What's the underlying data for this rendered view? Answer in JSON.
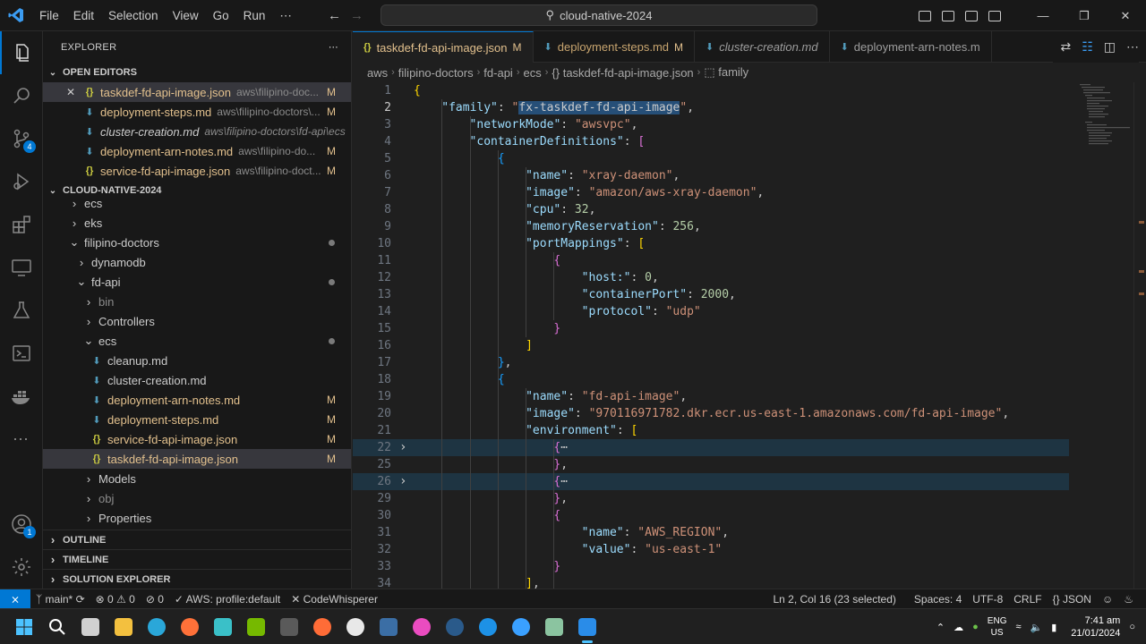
{
  "menu": [
    "File",
    "Edit",
    "Selection",
    "View",
    "Go",
    "Run",
    "⋯"
  ],
  "search": "cloud-native-2024",
  "window_controls": [
    "—",
    "❐",
    "✕"
  ],
  "activity": {
    "scm_badge": "4",
    "account_badge": "1"
  },
  "sidebar": {
    "title": "EXPLORER",
    "more": "⋯",
    "open_editors_header": "OPEN EDITORS",
    "open_editors": [
      {
        "name": "taskdef-fd-api-image.json",
        "path": "aws\\filipino-doc...",
        "status": "M",
        "icon": "{}",
        "type": "json"
      },
      {
        "name": "deployment-steps.md",
        "path": "aws\\filipino-doctors\\...",
        "status": "M",
        "icon": "⬇",
        "type": "md"
      },
      {
        "name": "cluster-creation.md",
        "path": "aws\\filipino-doctors\\fd-api\\ecs",
        "status": "",
        "icon": "⬇",
        "type": "md"
      },
      {
        "name": "deployment-arn-notes.md",
        "path": "aws\\filipino-do...",
        "status": "M",
        "icon": "⬇",
        "type": "md"
      },
      {
        "name": "service-fd-api-image.json",
        "path": "aws\\filipino-doct...",
        "status": "M",
        "icon": "{}",
        "type": "json"
      }
    ],
    "workspace_header": "CLOUD-NATIVE-2024",
    "tree": [
      {
        "label": "ecs",
        "depth": 1,
        "chev": "›",
        "type": "folder"
      },
      {
        "label": "eks",
        "depth": 1,
        "chev": "›",
        "type": "folder"
      },
      {
        "label": "filipino-doctors",
        "depth": 1,
        "chev": "⌄",
        "type": "folder"
      },
      {
        "label": "dynamodb",
        "depth": 2,
        "chev": "›",
        "type": "folder"
      },
      {
        "label": "fd-api",
        "depth": 2,
        "chev": "⌄",
        "type": "folder"
      },
      {
        "label": "bin",
        "depth": 3,
        "chev": "›",
        "type": "folder-dim"
      },
      {
        "label": "Controllers",
        "depth": 3,
        "chev": "›",
        "type": "folder"
      },
      {
        "label": "ecs",
        "depth": 3,
        "chev": "⌄",
        "type": "folder"
      },
      {
        "label": "cleanup.md",
        "depth": 4,
        "icon": "⬇",
        "type": "md",
        "status": ""
      },
      {
        "label": "cluster-creation.md",
        "depth": 4,
        "icon": "⬇",
        "type": "md",
        "status": ""
      },
      {
        "label": "deployment-arn-notes.md",
        "depth": 4,
        "icon": "⬇",
        "type": "md",
        "status": "M"
      },
      {
        "label": "deployment-steps.md",
        "depth": 4,
        "icon": "⬇",
        "type": "md",
        "status": "M"
      },
      {
        "label": "service-fd-api-image.json",
        "depth": 4,
        "icon": "{}",
        "type": "json",
        "status": "M"
      },
      {
        "label": "taskdef-fd-api-image.json",
        "depth": 4,
        "icon": "{}",
        "type": "json",
        "status": "M"
      },
      {
        "label": "Models",
        "depth": 3,
        "chev": "›",
        "type": "folder"
      },
      {
        "label": "obj",
        "depth": 3,
        "chev": "›",
        "type": "folder-dim"
      },
      {
        "label": "Properties",
        "depth": 3,
        "chev": "›",
        "type": "folder"
      }
    ],
    "bottom_sections": [
      "OUTLINE",
      "TIMELINE",
      "SOLUTION EXPLORER"
    ]
  },
  "tabs": [
    {
      "label": "taskdef-fd-api-image.json",
      "status": "M",
      "icon": "{}",
      "active": true,
      "italic": false
    },
    {
      "label": "deployment-steps.md",
      "status": "M",
      "icon": "⬇",
      "active": false,
      "italic": false
    },
    {
      "label": "cluster-creation.md",
      "status": "",
      "icon": "⬇",
      "active": false,
      "italic": true
    },
    {
      "label": "deployment-arn-notes.m",
      "status": "",
      "icon": "⬇",
      "active": false,
      "italic": false
    }
  ],
  "breadcrumb": [
    "aws",
    "filipino-doctors",
    "fd-api",
    "ecs",
    "{} taskdef-fd-api-image.json",
    "⬚ family"
  ],
  "editor": {
    "current_line": "2",
    "lines": [
      {
        "n": "1",
        "indent": 0,
        "tokens": [
          [
            "b1",
            "{"
          ]
        ]
      },
      {
        "n": "2",
        "indent": 1,
        "tokens": [
          [
            "k",
            "\"family\""
          ],
          [
            "p",
            ": "
          ],
          [
            "s",
            "\""
          ],
          [
            "sel",
            "fx-taskdef-fd-api-image"
          ],
          [
            "s",
            "\""
          ],
          [
            "p",
            ","
          ]
        ]
      },
      {
        "n": "3",
        "indent": 2,
        "tokens": [
          [
            "k",
            "\"networkMode\""
          ],
          [
            "p",
            ": "
          ],
          [
            "s",
            "\"awsvpc\""
          ],
          [
            "p",
            ","
          ]
        ]
      },
      {
        "n": "4",
        "indent": 2,
        "tokens": [
          [
            "k",
            "\"containerDefinitions\""
          ],
          [
            "p",
            ": "
          ],
          [
            "b2",
            "["
          ]
        ]
      },
      {
        "n": "5",
        "indent": 3,
        "tokens": [
          [
            "b3",
            "{"
          ]
        ]
      },
      {
        "n": "6",
        "indent": 4,
        "tokens": [
          [
            "k",
            "\"name\""
          ],
          [
            "p",
            ": "
          ],
          [
            "s",
            "\"xray-daemon\""
          ],
          [
            "p",
            ","
          ]
        ]
      },
      {
        "n": "7",
        "indent": 4,
        "tokens": [
          [
            "k",
            "\"image\""
          ],
          [
            "p",
            ": "
          ],
          [
            "s",
            "\"amazon/aws-xray-daemon\""
          ],
          [
            "p",
            ","
          ]
        ]
      },
      {
        "n": "8",
        "indent": 4,
        "tokens": [
          [
            "k",
            "\"cpu\""
          ],
          [
            "p",
            ": "
          ],
          [
            "n",
            "32"
          ],
          [
            "p",
            ","
          ]
        ]
      },
      {
        "n": "9",
        "indent": 4,
        "tokens": [
          [
            "k",
            "\"memoryReservation\""
          ],
          [
            "p",
            ": "
          ],
          [
            "n",
            "256"
          ],
          [
            "p",
            ","
          ]
        ]
      },
      {
        "n": "10",
        "indent": 4,
        "tokens": [
          [
            "k",
            "\"portMappings\""
          ],
          [
            "p",
            ": "
          ],
          [
            "b1",
            "["
          ]
        ]
      },
      {
        "n": "11",
        "indent": 5,
        "tokens": [
          [
            "b2",
            "{"
          ]
        ]
      },
      {
        "n": "12",
        "indent": 6,
        "tokens": [
          [
            "k",
            "\"host:\""
          ],
          [
            "p",
            ": "
          ],
          [
            "n",
            "0"
          ],
          [
            "p",
            ","
          ]
        ]
      },
      {
        "n": "13",
        "indent": 6,
        "tokens": [
          [
            "k",
            "\"containerPort\""
          ],
          [
            "p",
            ": "
          ],
          [
            "n",
            "2000"
          ],
          [
            "p",
            ","
          ]
        ]
      },
      {
        "n": "14",
        "indent": 6,
        "tokens": [
          [
            "k",
            "\"protocol\""
          ],
          [
            "p",
            ": "
          ],
          [
            "s",
            "\"udp\""
          ]
        ]
      },
      {
        "n": "15",
        "indent": 5,
        "tokens": [
          [
            "b2",
            "}"
          ]
        ]
      },
      {
        "n": "16",
        "indent": 4,
        "tokens": [
          [
            "b1",
            "]"
          ]
        ]
      },
      {
        "n": "17",
        "indent": 3,
        "tokens": [
          [
            "b3",
            "}"
          ],
          [
            "p",
            ","
          ]
        ]
      },
      {
        "n": "18",
        "indent": 3,
        "tokens": [
          [
            "b3",
            "{"
          ]
        ]
      },
      {
        "n": "19",
        "indent": 4,
        "tokens": [
          [
            "k",
            "\"name\""
          ],
          [
            "p",
            ": "
          ],
          [
            "s",
            "\"fd-api-image\""
          ],
          [
            "p",
            ","
          ]
        ]
      },
      {
        "n": "20",
        "indent": 4,
        "tokens": [
          [
            "k",
            "\"image\""
          ],
          [
            "p",
            ": "
          ],
          [
            "s",
            "\"970116971782.dkr.ecr.us-east-1.amazonaws.com/fd-api-image\""
          ],
          [
            "p",
            ","
          ]
        ]
      },
      {
        "n": "21",
        "indent": 4,
        "tokens": [
          [
            "k",
            "\"environment\""
          ],
          [
            "p",
            ": "
          ],
          [
            "b1",
            "["
          ]
        ]
      },
      {
        "n": "22",
        "indent": 5,
        "fold": true,
        "tokens": [
          [
            "b2",
            "{"
          ],
          [
            "p",
            "⋯"
          ]
        ]
      },
      {
        "n": "25",
        "indent": 5,
        "tokens": [
          [
            "b2",
            "}"
          ],
          [
            "p",
            ","
          ]
        ]
      },
      {
        "n": "26",
        "indent": 5,
        "fold": true,
        "tokens": [
          [
            "b2",
            "{"
          ],
          [
            "p",
            "⋯"
          ]
        ]
      },
      {
        "n": "29",
        "indent": 5,
        "tokens": [
          [
            "b2",
            "}"
          ],
          [
            "p",
            ","
          ]
        ]
      },
      {
        "n": "30",
        "indent": 5,
        "tokens": [
          [
            "b2",
            "{"
          ]
        ]
      },
      {
        "n": "31",
        "indent": 6,
        "tokens": [
          [
            "k",
            "\"name\""
          ],
          [
            "p",
            ": "
          ],
          [
            "s",
            "\"AWS_REGION\""
          ],
          [
            "p",
            ","
          ]
        ]
      },
      {
        "n": "32",
        "indent": 6,
        "tokens": [
          [
            "k",
            "\"value\""
          ],
          [
            "p",
            ": "
          ],
          [
            "s",
            "\"us-east-1\""
          ]
        ]
      },
      {
        "n": "33",
        "indent": 5,
        "tokens": [
          [
            "b2",
            "}"
          ]
        ]
      },
      {
        "n": "34",
        "indent": 4,
        "tokens": [
          [
            "b1",
            "]"
          ],
          [
            "p",
            ","
          ]
        ]
      }
    ]
  },
  "statusbar": {
    "remote": "⨯",
    "branch": "main*",
    "sync": "⟳",
    "errors": "⊗ 0",
    "warnings": "⚠ 0",
    "ports": "⊘ 0",
    "aws": "✓ AWS: profile:default",
    "codewhisperer": "✕ CodeWhisperer",
    "position": "Ln 2, Col 16 (23 selected)",
    "spaces": "Spaces: 4",
    "encoding": "UTF-8",
    "eol": "CRLF",
    "language": "{} JSON"
  },
  "taskbar": {
    "lang_top": "ENG",
    "lang_bottom": "US",
    "time": "7:41 am",
    "date": "21/01/2024",
    "icons": [
      {
        "name": "start-icon",
        "color": "#4cc2ff"
      },
      {
        "name": "search-taskbar-icon",
        "color": "#ffffff"
      },
      {
        "name": "task-view-icon",
        "color": "#d0d0d0"
      },
      {
        "name": "file-explorer-icon",
        "color": "#f3c03f"
      },
      {
        "name": "edge-icon",
        "color": "#2aa7d9"
      },
      {
        "name": "firefox-icon",
        "color": "#ff7139"
      },
      {
        "name": "store-icon",
        "color": "#3ac0c8"
      },
      {
        "name": "nvidia-icon",
        "color": "#76b900"
      },
      {
        "name": "terminal-icon",
        "color": "#5a5a5a"
      },
      {
        "name": "postman-icon",
        "color": "#ff6c37"
      },
      {
        "name": "obs-icon",
        "color": "#e8e8e8"
      },
      {
        "name": "davinci-icon",
        "color": "#3b6ea5"
      },
      {
        "name": "itunes-icon",
        "color": "#ea4cc0"
      },
      {
        "name": "steam-icon",
        "color": "#2a5a8a"
      },
      {
        "name": "docker-icon",
        "color": "#1d91e6"
      },
      {
        "name": "app-store-icon",
        "color": "#3aa0ff"
      },
      {
        "name": "notepad-icon",
        "color": "#8bc4a0"
      },
      {
        "name": "vscode-icon",
        "color": "#2a8ce8"
      }
    ]
  }
}
